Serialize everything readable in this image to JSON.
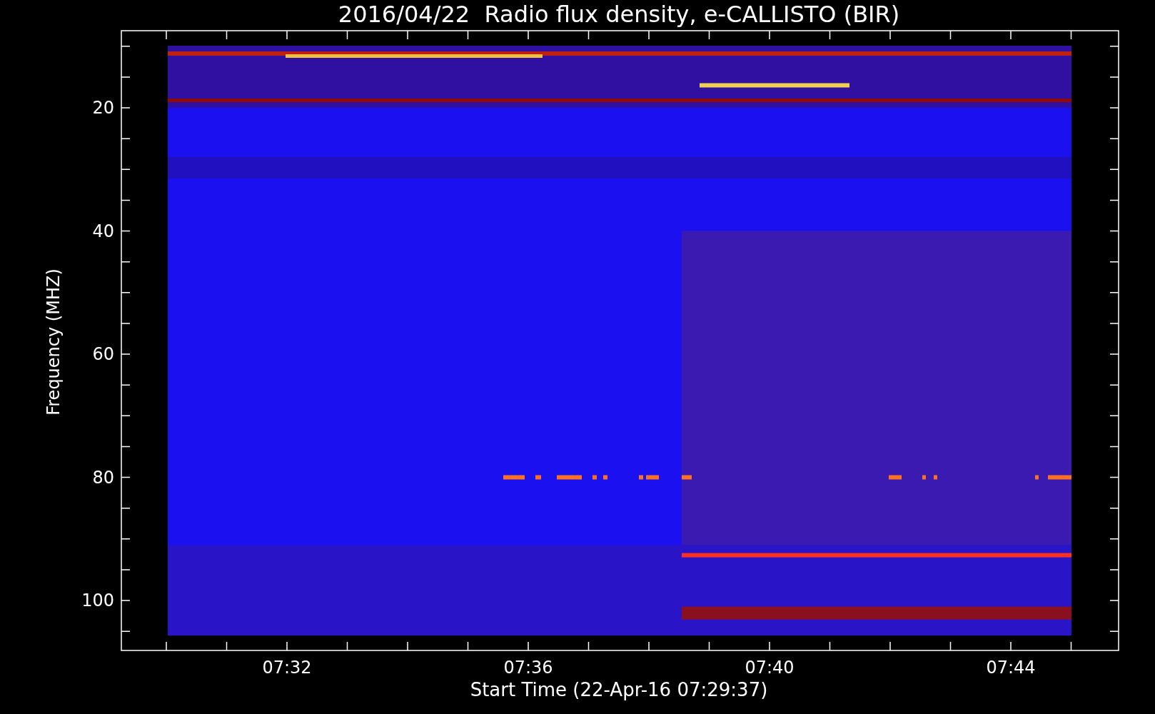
{
  "title": "2016/04/22  Radio flux density, e-CALLISTO (BIR)",
  "y_axis": {
    "label": "Frequency (MHZ)",
    "ticks": [
      "20",
      "40",
      "60",
      "80",
      "100"
    ]
  },
  "x_axis": {
    "label": "Start Time (22-Apr-16 07:29:37)",
    "ticks": [
      "07:32",
      "07:36",
      "07:40",
      "07:44"
    ]
  }
}
